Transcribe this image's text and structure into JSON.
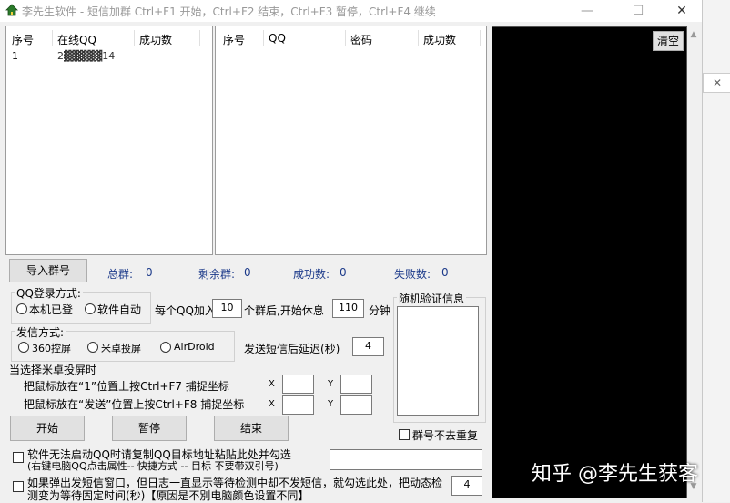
{
  "window": {
    "title": "李先生软件 - 短信加群 Ctrl+F1 开始，Ctrl+F2 结束，Ctrl+F3 暂停，Ctrl+F4 继续",
    "minimize": "—",
    "maximize": "☐",
    "close": "✕"
  },
  "online_table": {
    "headers": [
      "序号",
      "在线QQ",
      "成功数"
    ],
    "rows": [
      [
        "1",
        "2▓▓▓▓▓14",
        ""
      ]
    ]
  },
  "qq_table": {
    "headers": [
      "序号",
      "QQ",
      "密码",
      "成功数"
    ]
  },
  "log_panel": {
    "clear_label": "清空"
  },
  "import_button": "导入群号",
  "stats": {
    "total_label": "总群:",
    "total": "0",
    "remaining_label": "剩余群:",
    "remaining": "0",
    "success_label": "成功数:",
    "success": "0",
    "fail_label": "失败数:",
    "fail": "0"
  },
  "login_mode": {
    "legend": "QQ登录方式:",
    "options": [
      "本机已登",
      "软件自动"
    ]
  },
  "per_qq": {
    "prefix": "每个QQ加入",
    "count": "10",
    "middle": "个群后,开始休息",
    "rest": "110",
    "unit": "分钟"
  },
  "send_mode": {
    "legend": "发信方式:",
    "options": [
      "360控屏",
      "米卓投屏",
      "AirDroid"
    ]
  },
  "delay": {
    "label": "发送短信后延迟(秒)",
    "value": "4"
  },
  "mirror": {
    "heading": "当选择米卓投屏时",
    "line1": "把鼠标放在“1”位置上按Ctrl+F7 捕捉坐标",
    "line2": "把鼠标放在“发送”位置上按Ctrl+F8 捕捉坐标",
    "x_label": "X",
    "y_label": "Y"
  },
  "random_verify": {
    "legend": "随机验证信息"
  },
  "buttons": {
    "start": "开始",
    "pause": "暂停",
    "stop": "结束"
  },
  "no_dup": "群号不去重复",
  "option1": {
    "line1": "软件无法启动QQ时请复制QQ目标地址粘贴此处并勾选",
    "line2": "(右键电脑QQ点击属性-- 快捷方式 -- 目标 不要带双引号)"
  },
  "option2": {
    "line1": "如果弹出发短信窗口，但日志一直显示等待检测中却不发短信，就勾选此处，把动态检",
    "line2": "测变为等待固定时间(秒)【原因是不別电脑颜色设置不同】",
    "value": "4"
  },
  "watermark": "知乎 @李先生获客"
}
